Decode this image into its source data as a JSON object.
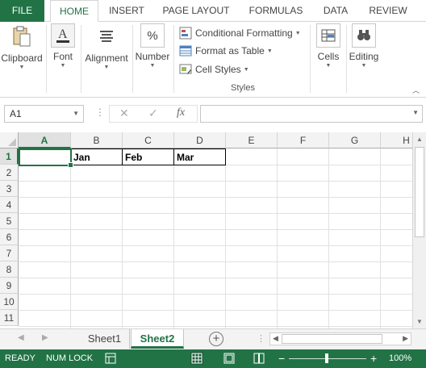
{
  "ribbon": {
    "tabs": [
      "FILE",
      "HOME",
      "INSERT",
      "PAGE LAYOUT",
      "FORMULAS",
      "DATA",
      "REVIEW"
    ],
    "active_tab": "HOME",
    "groups": {
      "clipboard": "Clipboard",
      "font": "Font",
      "alignment": "Alignment",
      "number": "Number",
      "cells": "Cells",
      "editing": "Editing"
    },
    "styles": {
      "conditional_formatting": "Conditional Formatting",
      "format_as_table": "Format as Table",
      "cell_styles": "Cell Styles",
      "group_label": "Styles"
    },
    "number_glyph": "%",
    "font_glyph": "A"
  },
  "formula_bar": {
    "name_box": "A1",
    "fx": "fx",
    "formula": ""
  },
  "sheet": {
    "columns": [
      "A",
      "B",
      "C",
      "D",
      "E",
      "F",
      "G",
      "H"
    ],
    "rows": [
      "1",
      "2",
      "3",
      "4",
      "5",
      "6",
      "7",
      "8",
      "9",
      "10",
      "11"
    ],
    "active_cell": "A1",
    "cells": {
      "B1": "Jan",
      "C1": "Feb",
      "D1": "Mar"
    }
  },
  "sheet_tabs": {
    "tabs": [
      "Sheet1",
      "Sheet2"
    ],
    "active": "Sheet2"
  },
  "status_bar": {
    "ready": "READY",
    "num_lock": "NUM LOCK",
    "zoom": "100%",
    "zoom_minus": "−",
    "zoom_plus": "+"
  },
  "colors": {
    "accent": "#217346"
  },
  "icons": [
    "clipboard-icon",
    "font-icon",
    "alignment-icon",
    "number-icon",
    "conditional-formatting-icon",
    "format-as-table-icon",
    "cell-styles-icon",
    "cells-icon",
    "editing-icon",
    "cancel-icon",
    "enter-icon",
    "fx-icon",
    "add-sheet-icon",
    "normal-view-icon",
    "page-layout-view-icon",
    "page-break-view-icon"
  ]
}
